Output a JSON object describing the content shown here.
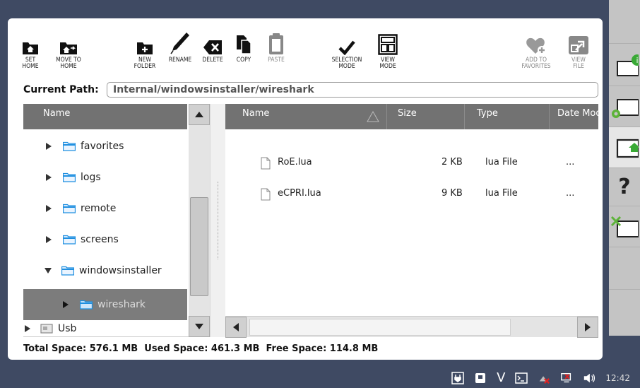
{
  "toolbar": {
    "set_home": "SET\nHOME",
    "move_to_home": "MOVE TO\nHOME",
    "new_folder": "NEW\nFOLDER",
    "rename": "RENAME",
    "delete": "DELETE",
    "copy": "COPY",
    "paste": "PASTE",
    "selection_mode": "SELECTION\nMODE",
    "view_mode": "VIEW\nMODE",
    "add_to_favorites": "ADD TO\nFAVORITES",
    "view_file": "VIEW\nFILE"
  },
  "path": {
    "label": "Current Path:",
    "value": "Internal/windowsinstaller/wireshark"
  },
  "tree": {
    "header": "Name",
    "items": [
      {
        "label": "favorites"
      },
      {
        "label": "logs"
      },
      {
        "label": "remote"
      },
      {
        "label": "screens"
      },
      {
        "label": "windowsinstaller"
      },
      {
        "label": "wireshark"
      },
      {
        "label": "Usb"
      }
    ]
  },
  "files": {
    "columns": [
      "Name",
      "Size",
      "Type",
      "Date Mod"
    ],
    "rows": [
      {
        "name": "RoE.lua",
        "size": "2 KB",
        "type": "lua File",
        "date": "..."
      },
      {
        "name": "eCPRI.lua",
        "size": "9 KB",
        "type": "lua File",
        "date": "..."
      }
    ]
  },
  "footer": {
    "total": "Total Space: 576.1 MB",
    "used": "Used Space: 461.3 MB",
    "free": "Free Space: 114.8 MB"
  },
  "taskbar": {
    "v_label": "V",
    "clock": "12:42"
  },
  "colors": {
    "folder_blue": "#1f8fe0",
    "header_gray": "#727272",
    "selected_row": "#7c7c7c",
    "help_badge_green": "#39a935"
  }
}
